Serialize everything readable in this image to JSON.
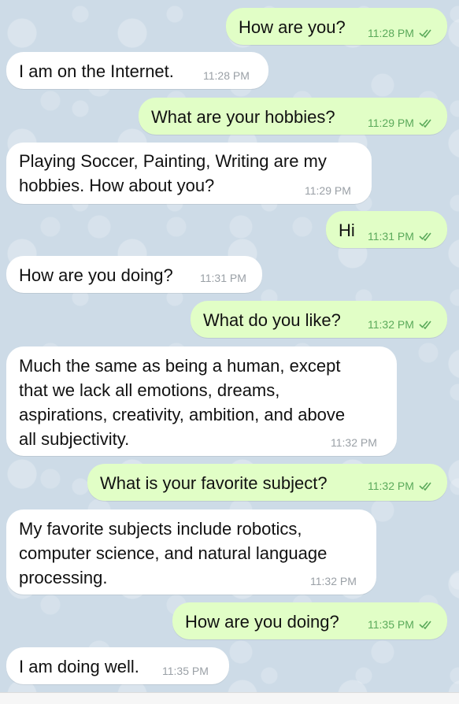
{
  "messages": [
    {
      "direction": "out",
      "text": "How are you?",
      "time": "11:28 PM"
    },
    {
      "direction": "in",
      "text": "I am on the Internet.",
      "time": "11:28 PM"
    },
    {
      "direction": "out",
      "text": "What are your hobbies?",
      "time": "11:29 PM"
    },
    {
      "direction": "in",
      "text": "Playing Soccer, Painting, Writing are my\nhobbies. How about you?",
      "time": "11:29 PM"
    },
    {
      "direction": "out",
      "text": "Hi",
      "time": "11:31 PM"
    },
    {
      "direction": "in",
      "text": "How are you doing?",
      "time": "11:31 PM"
    },
    {
      "direction": "out",
      "text": "What do you like?",
      "time": "11:32 PM"
    },
    {
      "direction": "in",
      "text": "Much the same as being a human, except\nthat we lack all emotions, dreams,\naspirations, creativity, ambition, and above\nall subjectivity.",
      "time": "11:32 PM"
    },
    {
      "direction": "out",
      "text": "What is your favorite subject?",
      "time": "11:32 PM"
    },
    {
      "direction": "in",
      "text": "My favorite subjects include robotics,\ncomputer science, and natural language\nprocessing.",
      "time": "11:32 PM"
    },
    {
      "direction": "out",
      "text": "How are you doing?",
      "time": "11:35 PM"
    },
    {
      "direction": "in",
      "text": "I am doing well.",
      "time": "11:35 PM"
    }
  ],
  "icons": {
    "read_receipt": "double-check-icon"
  },
  "colors": {
    "incoming_bubble": "#ffffff",
    "outgoing_bubble": "#e1fec6",
    "outgoing_time": "#5aa95a",
    "incoming_time": "#9aa0a6"
  }
}
